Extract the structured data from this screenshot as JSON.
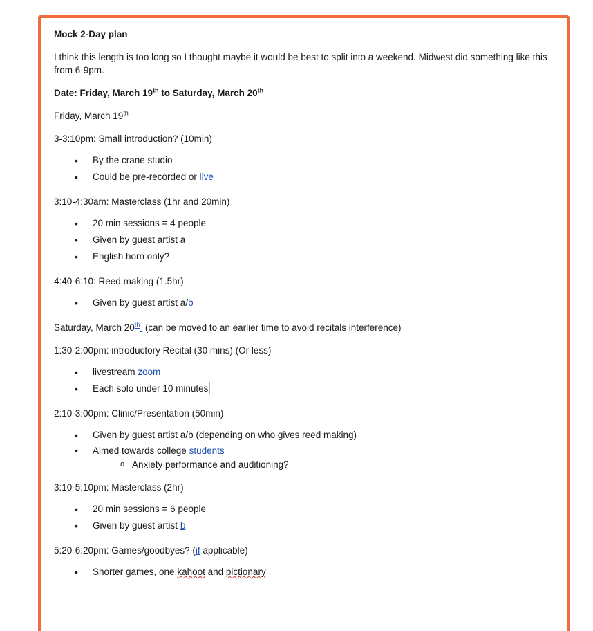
{
  "doc": {
    "title": "Mock 2-Day plan",
    "intro": "I think this length is too long so I thought maybe it would be best to split into a weekend. Midwest did something like this from 6-9pm.",
    "date_line": {
      "a": "Date: Friday, March 19",
      "sup1": "th",
      "b": " to Saturday, March 20",
      "sup2": "th"
    },
    "friday": {
      "text": "Friday, March 19",
      "sup": "th"
    },
    "s1": {
      "heading": "3-3:10pm: Small introduction? (10min)",
      "items": [
        "By the crane studio",
        "Could be pre-recorded or ",
        "live"
      ]
    },
    "s2": {
      "heading": "3:10-4:30am: Masterclass (1hr and 20min)",
      "items": [
        "20 min sessions = 4 people",
        "Given by guest artist a",
        "English horn only?"
      ]
    },
    "s3": {
      "heading": "4:40-6:10: Reed making (1.5hr)",
      "item_text": "Given by guest artist a/",
      "item_link": "b"
    },
    "saturday": {
      "text": "Saturday, March 20",
      "sup": "th",
      "rest": " (can be moved to an earlier time to avoid recitals interference)"
    },
    "s4": {
      "heading": "1:30-2:00pm: introductory Recital (30 mins) (Or less)",
      "item1_text": "livestream ",
      "item1_link": "zoom",
      "item2": "Each solo under 10 minutes"
    },
    "s5": {
      "heading": "2:10-3:00pm: Clinic/Presentation (50min)",
      "item1": "Given by guest artist a/b (depending on who gives reed making)",
      "item2_text": "Aimed towards college ",
      "item2_link": "students",
      "sub": "Anxiety performance and auditioning?"
    },
    "s6": {
      "heading": "3:10-5:10pm: Masterclass (2hr)",
      "item1": "20 min sessions = 6 people",
      "item2_text": "Given by guest artist ",
      "item2_link": "b"
    },
    "s7": {
      "heading_a": "5:20-6:20pm: Games/goodbyes? (",
      "heading_link": "if",
      "heading_b": " applicable)",
      "item_a": "Shorter games, one ",
      "item_k": "kahoot",
      "item_m": " and ",
      "item_p": "pictionary"
    },
    "bullet": "•",
    "sub_bullet": "o"
  },
  "colors": {
    "frame": "#f26a3d",
    "link": "#1f4fb3"
  }
}
